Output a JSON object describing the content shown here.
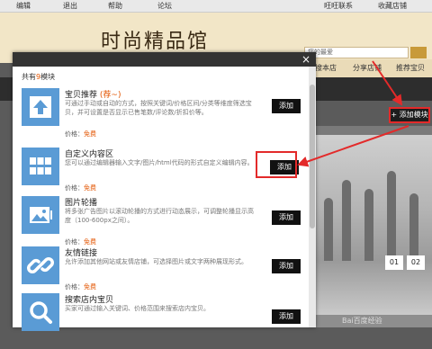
{
  "topbar": {
    "items": [
      "编辑",
      "退出",
      "帮助",
      "论坛",
      "旺旺联系",
      "收藏店铺"
    ]
  },
  "header": {
    "shop_title": "时尚精品馆"
  },
  "search": {
    "placeholder": "您的最爱"
  },
  "nav": {
    "items": [
      "搜本店",
      "分享店铺",
      "推荐宝贝"
    ]
  },
  "add_module_button": "添加模块",
  "slider_pages": [
    "01",
    "02"
  ],
  "watermark": "Bai百度经验",
  "modal": {
    "count_prefix": "共有",
    "count_value": "9",
    "count_suffix": "模块",
    "close_label": "×",
    "items": [
      {
        "name": "宝贝推荐",
        "hot": "(荐~)",
        "desc": "可通过手动或自动的方式，按照关键词/价格区间/分类等维度筛选宝贝，并可设置是否显示已售笔数/评论数/折扣价等。",
        "price_label": "价格：",
        "price": "免费",
        "button": "添加",
        "icon": "upload-icon"
      },
      {
        "name": "自定义内容区",
        "hot": "",
        "desc": "您可以通过编辑器输入文字/图片/html代码的形式自定义编辑内容。",
        "price_label": "价格：",
        "price": "免费",
        "button": "添加",
        "icon": "grid-icon"
      },
      {
        "name": "图片轮播",
        "hot": "",
        "desc": "将多张广告图片以滚动轮播的方式进行动态展示，可调整轮播显示高度（100-600px之间）。",
        "price_label": "价格：",
        "price": "免费",
        "button": "添加",
        "icon": "image-icon"
      },
      {
        "name": "友情链接",
        "hot": "",
        "desc": "允许添加其他网站或友情店铺，可选择图片或文字两种展现形式。",
        "price_label": "价格：",
        "price": "免费",
        "button": "添加",
        "icon": "link-icon"
      },
      {
        "name": "搜索店内宝贝",
        "hot": "",
        "desc": "买家可通过输入关键词、价格范围来搜索店内宝贝。",
        "price_label": "价格：",
        "price": "免费",
        "button": "添加",
        "icon": "search-icon"
      }
    ]
  },
  "colors": {
    "accent": "#e35400",
    "highlight": "#e32a2a",
    "icon_bg": "#5a9bd5",
    "modal_header": "#333333"
  }
}
